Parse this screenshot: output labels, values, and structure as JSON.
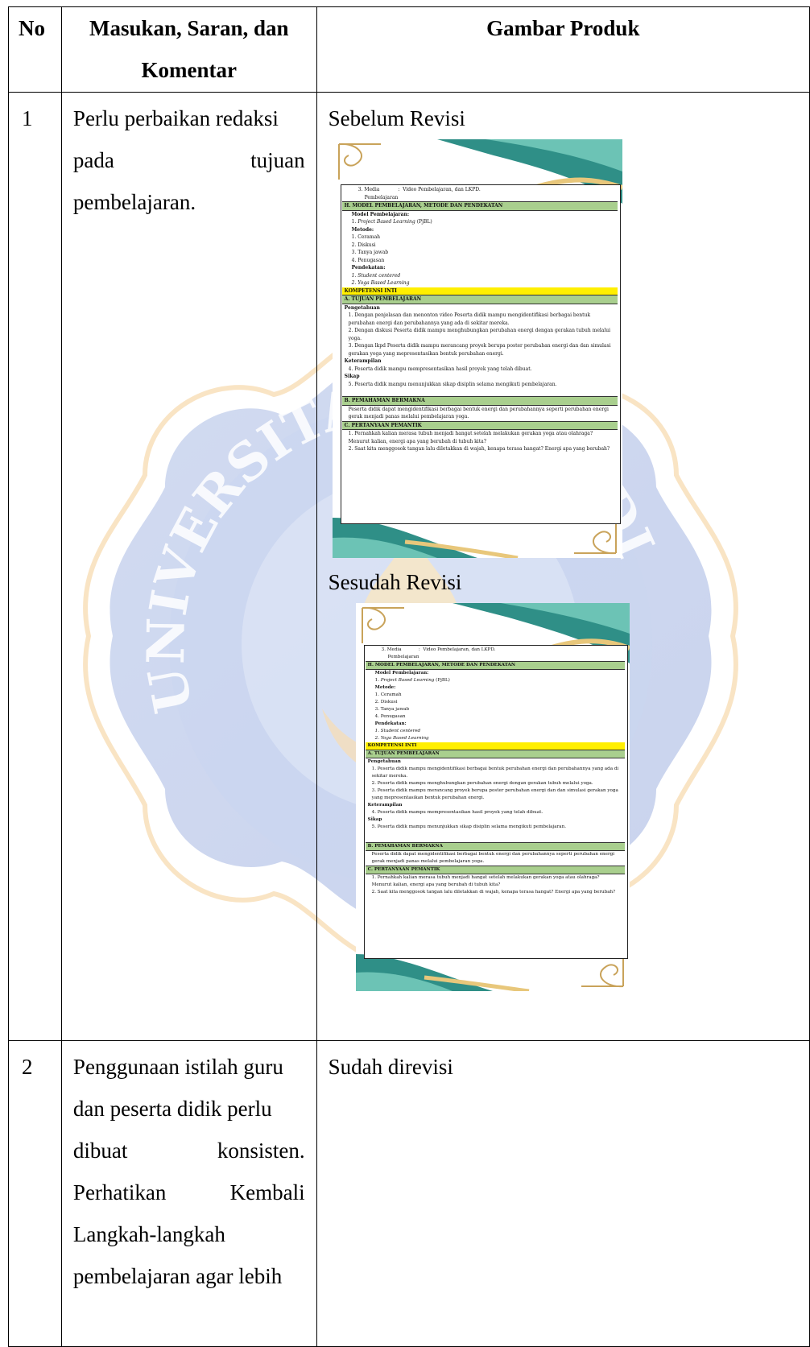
{
  "header": {
    "no": "No",
    "masukan_line1": "Masukan, Saran, dan",
    "masukan_line2": "Komentar",
    "gambar": "Gambar Produk"
  },
  "rows": [
    {
      "no": "1",
      "comment_lines": [
        [
          "Perlu perbaikan redaksi"
        ],
        [
          "pada",
          "tujuan"
        ],
        [
          "pembelajaran."
        ]
      ],
      "before_label": "Sebelum Revisi",
      "after_label": "Sesudah Revisi"
    },
    {
      "no": "2",
      "comment_lines": [
        [
          "Penggunaan istilah guru"
        ],
        [
          "dan peserta didik perlu"
        ],
        [
          "dibuat",
          "konsisten."
        ],
        [
          "Perhatikan",
          "Kembali"
        ],
        [
          "Langkah-langkah"
        ],
        [
          "pembelajaran agar lebih"
        ]
      ],
      "result": "Sudah direvisi"
    }
  ],
  "doc_before": {
    "media_num": "3.",
    "media_label": "Media",
    "media_sep": ":",
    "media_value": "Video Pembelajaran, dan LKPD.",
    "media_cont": "Pembelajaran",
    "sec_h": "H. MODEL PEMBELAJARAN, METODE DAN PENDEKATAN",
    "model_head": "Model Pembelajaran:",
    "model_1_num": "1.",
    "model_1_italic": "Project Based Learning",
    "model_1_rest": "(PjBL)",
    "metode_head": "Metode:",
    "metode_items": [
      "1.  Ceramah",
      "2.  Diskusi",
      "3.  Tanya jawab",
      "4.  Penugasan"
    ],
    "pendekatan_head": "Pendekatan:",
    "pendekatan_items": [
      "1.  Student centered",
      "2.  Yoga Based Learning"
    ],
    "kompetensi": "KOMPETENSI INTI",
    "sec_a": "A. TUJUAN PEMBELAJARAN",
    "pengetahuan": "Pengetahuan",
    "tujuan_items": [
      "1.  Dengan penjelasan dan menonton video Peserta didik mampu mengidentifikasi berbagai bentuk perubahan energi dan perubahannya yang ada di sekitar mereka.",
      "2.  Dengan diskusi  Peserta didik mampu menghubungkan perubahan energi dengan gerakan tubuh melalui yoga.",
      "3.  Dengan lkpd Peserta didik mampu merancang proyek berupa poster perubahan energi dan dan simulasi gerakan yoga yang mepresentasikan bentuk perubahan energi."
    ],
    "keterampilan": "Keterampilan",
    "ket_item": "4.  Peserta didik mampu mempresentasikan hasil proyek yang telah dibuat.",
    "sikap": "Sikap",
    "sikap_item": "5.  Peserta didik mampu menunjukkan sikap disiplin selama mengikuti pembelajaran.",
    "sec_b": "B.  PEMAHAMAN BERMAKNA",
    "pemahaman": "Peserta didik dapat mengidentifikasi berbagai bentuk energi dan perubahannya seperti perubahan energi gerak menjadi panas melalui pembelajaran yoga.",
    "sec_c": "C.  PERTANYAAN PEMANTIK",
    "pemantik_items": [
      "1.  Pernahkah kalian merasa tubuh menjadi hangat setelah melakukan gerakan yoga atau olahraga? Menurut kalian, energi apa yang berubah di tubuh kita?",
      "2.  Saat kita menggosok tangan lalu diletakkan di wajah, kenapa terasa hangat? Energi apa yang berubah?"
    ]
  },
  "doc_after": {
    "media_num": "3.",
    "media_label": "Media",
    "media_sep": ":",
    "media_value": "Video Pembelajaran, dan LKPD.",
    "media_cont": "Pembelajaran",
    "sec_h": "H. MODEL PEMBELAJARAN, METODE DAN PENDEKATAN",
    "model_head": "Model Pembelajaran:",
    "model_1_num": "1.",
    "model_1_italic": "Project Based Learning",
    "model_1_rest": "(PjBL)",
    "metode_head": "Metode:",
    "metode_items": [
      "1.  Ceramah",
      "2.  Diskusi",
      "3.  Tanya jawab",
      "4.  Penugasan"
    ],
    "pendekatan_head": "Pendekatan:",
    "pendekatan_items": [
      "1.  Student centered",
      "2.  Yoga Based Learning"
    ],
    "kompetensi": "KOMPETENSI INTI",
    "sec_a": "A. TUJUAN PEMBELAJARAN",
    "pengetahuan": "Pengetahuan",
    "tujuan_items": [
      "1.  Peserta didik mampu mengidentifikasi berbagai bentuk perubahan energi dan perubahannya yang ada di sekitar mereka.",
      "2.  Peserta didik mampu menghubungkan perubahan energi dengan gerakan tubuh melalui yoga.",
      "3.  Peserta didik mampu merancang proyek berupa poster perubahan energi dan dan simulasi gerakan yoga yang mepresentasikan bentuk perubahan energi."
    ],
    "keterampilan": "Keterampilan",
    "ket_item": "4.  Peserta didik mampu mempresentasikan hasil proyek yang telah dibuat.",
    "sikap": "Sikap",
    "sikap_item": "5.  Peserta didik mampu menunjukkan sikap disiplin selama mengikuti pembelajaran.",
    "sec_b": "B.  PEMAHAMAN BERMAKNA",
    "pemahaman": "Peserta didik dapat mengidentifikasi berbagai bentuk energi dan perubahannya seperti perubahan energi gerak menjadi panas melalui pembelajaran yoga.",
    "sec_c": "C.  PERTANYAAN PEMANTIK",
    "pemantik_items": [
      "1.  Pernahkah kalian merasa tubuh menjadi hangat setelah melakukan gerakan yoga atau olahraga? Menurut kalian, energi apa yang berubah di tubuh kita?",
      "2.  Saat kita menggosok tangan lalu diletakkan di wajah, kenapa terasa hangat? Energi apa yang berubah?"
    ]
  }
}
